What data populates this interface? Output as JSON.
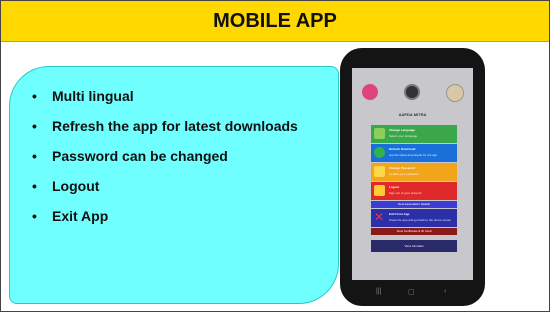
{
  "slide": {
    "title": "MOBILE APP",
    "features": [
      "Multi lingual",
      "Refresh the app for latest downloads",
      "Password can be changed",
      "Logout",
      "Exit App"
    ]
  },
  "phone": {
    "brand": "AAPDA MITRA",
    "menu": [
      {
        "title": "Change Language",
        "sub": "Select your language",
        "color": "#3aa84a"
      },
      {
        "title": "Refresh Download",
        "sub": "Get the latest downloads for the app",
        "color": "#1a6fd8"
      },
      {
        "title": "Change Password",
        "sub": "Update your password",
        "color": "#f2a41a"
      },
      {
        "title": "Logout",
        "sub": "Sign out of your account",
        "color": "#e02a2a"
      },
      {
        "title": "Exit From App",
        "sub": "Close the app and go back to the home screen",
        "color": "#2b2fa8"
      }
    ],
    "thin_items": [
      {
        "label": "New Association Details",
        "color": "#3c3cd2"
      },
      {
        "label": "View Certificate & ID Card",
        "color": "#8a1a1a"
      },
      {
        "label": "View Circulars",
        "color": "#2a2a6a"
      }
    ],
    "navbar": {
      "back_icon": "back-icon",
      "home_icon": "home-icon",
      "recent_icon": "recent-icon"
    }
  },
  "colors": {
    "title_bg": "#ffd800",
    "panel_bg": "#6fffff"
  }
}
